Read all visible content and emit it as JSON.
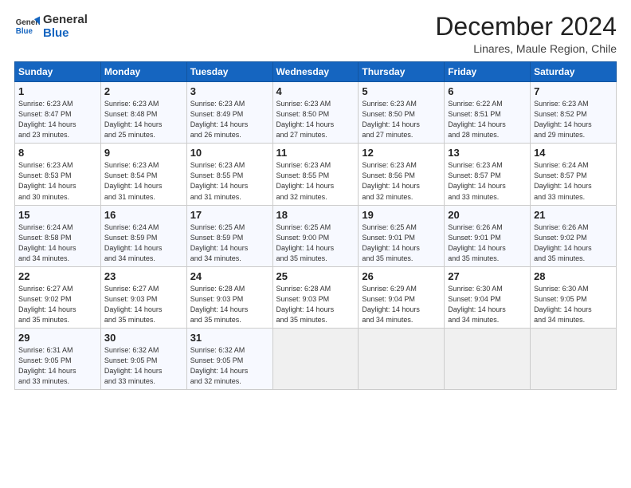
{
  "logo": {
    "line1": "General",
    "line2": "Blue"
  },
  "title": "December 2024",
  "location": "Linares, Maule Region, Chile",
  "days_of_week": [
    "Sunday",
    "Monday",
    "Tuesday",
    "Wednesday",
    "Thursday",
    "Friday",
    "Saturday"
  ],
  "weeks": [
    [
      {
        "day": "1",
        "info": "Sunrise: 6:23 AM\nSunset: 8:47 PM\nDaylight: 14 hours\nand 23 minutes."
      },
      {
        "day": "2",
        "info": "Sunrise: 6:23 AM\nSunset: 8:48 PM\nDaylight: 14 hours\nand 25 minutes."
      },
      {
        "day": "3",
        "info": "Sunrise: 6:23 AM\nSunset: 8:49 PM\nDaylight: 14 hours\nand 26 minutes."
      },
      {
        "day": "4",
        "info": "Sunrise: 6:23 AM\nSunset: 8:50 PM\nDaylight: 14 hours\nand 27 minutes."
      },
      {
        "day": "5",
        "info": "Sunrise: 6:23 AM\nSunset: 8:50 PM\nDaylight: 14 hours\nand 27 minutes."
      },
      {
        "day": "6",
        "info": "Sunrise: 6:22 AM\nSunset: 8:51 PM\nDaylight: 14 hours\nand 28 minutes."
      },
      {
        "day": "7",
        "info": "Sunrise: 6:23 AM\nSunset: 8:52 PM\nDaylight: 14 hours\nand 29 minutes."
      }
    ],
    [
      {
        "day": "8",
        "info": "Sunrise: 6:23 AM\nSunset: 8:53 PM\nDaylight: 14 hours\nand 30 minutes."
      },
      {
        "day": "9",
        "info": "Sunrise: 6:23 AM\nSunset: 8:54 PM\nDaylight: 14 hours\nand 31 minutes."
      },
      {
        "day": "10",
        "info": "Sunrise: 6:23 AM\nSunset: 8:55 PM\nDaylight: 14 hours\nand 31 minutes."
      },
      {
        "day": "11",
        "info": "Sunrise: 6:23 AM\nSunset: 8:55 PM\nDaylight: 14 hours\nand 32 minutes."
      },
      {
        "day": "12",
        "info": "Sunrise: 6:23 AM\nSunset: 8:56 PM\nDaylight: 14 hours\nand 32 minutes."
      },
      {
        "day": "13",
        "info": "Sunrise: 6:23 AM\nSunset: 8:57 PM\nDaylight: 14 hours\nand 33 minutes."
      },
      {
        "day": "14",
        "info": "Sunrise: 6:24 AM\nSunset: 8:57 PM\nDaylight: 14 hours\nand 33 minutes."
      }
    ],
    [
      {
        "day": "15",
        "info": "Sunrise: 6:24 AM\nSunset: 8:58 PM\nDaylight: 14 hours\nand 34 minutes."
      },
      {
        "day": "16",
        "info": "Sunrise: 6:24 AM\nSunset: 8:59 PM\nDaylight: 14 hours\nand 34 minutes."
      },
      {
        "day": "17",
        "info": "Sunrise: 6:25 AM\nSunset: 8:59 PM\nDaylight: 14 hours\nand 34 minutes."
      },
      {
        "day": "18",
        "info": "Sunrise: 6:25 AM\nSunset: 9:00 PM\nDaylight: 14 hours\nand 35 minutes."
      },
      {
        "day": "19",
        "info": "Sunrise: 6:25 AM\nSunset: 9:01 PM\nDaylight: 14 hours\nand 35 minutes."
      },
      {
        "day": "20",
        "info": "Sunrise: 6:26 AM\nSunset: 9:01 PM\nDaylight: 14 hours\nand 35 minutes."
      },
      {
        "day": "21",
        "info": "Sunrise: 6:26 AM\nSunset: 9:02 PM\nDaylight: 14 hours\nand 35 minutes."
      }
    ],
    [
      {
        "day": "22",
        "info": "Sunrise: 6:27 AM\nSunset: 9:02 PM\nDaylight: 14 hours\nand 35 minutes."
      },
      {
        "day": "23",
        "info": "Sunrise: 6:27 AM\nSunset: 9:03 PM\nDaylight: 14 hours\nand 35 minutes."
      },
      {
        "day": "24",
        "info": "Sunrise: 6:28 AM\nSunset: 9:03 PM\nDaylight: 14 hours\nand 35 minutes."
      },
      {
        "day": "25",
        "info": "Sunrise: 6:28 AM\nSunset: 9:03 PM\nDaylight: 14 hours\nand 35 minutes."
      },
      {
        "day": "26",
        "info": "Sunrise: 6:29 AM\nSunset: 9:04 PM\nDaylight: 14 hours\nand 34 minutes."
      },
      {
        "day": "27",
        "info": "Sunrise: 6:30 AM\nSunset: 9:04 PM\nDaylight: 14 hours\nand 34 minutes."
      },
      {
        "day": "28",
        "info": "Sunrise: 6:30 AM\nSunset: 9:05 PM\nDaylight: 14 hours\nand 34 minutes."
      }
    ],
    [
      {
        "day": "29",
        "info": "Sunrise: 6:31 AM\nSunset: 9:05 PM\nDaylight: 14 hours\nand 33 minutes."
      },
      {
        "day": "30",
        "info": "Sunrise: 6:32 AM\nSunset: 9:05 PM\nDaylight: 14 hours\nand 33 minutes."
      },
      {
        "day": "31",
        "info": "Sunrise: 6:32 AM\nSunset: 9:05 PM\nDaylight: 14 hours\nand 32 minutes."
      },
      {
        "day": "",
        "info": ""
      },
      {
        "day": "",
        "info": ""
      },
      {
        "day": "",
        "info": ""
      },
      {
        "day": "",
        "info": ""
      }
    ]
  ]
}
